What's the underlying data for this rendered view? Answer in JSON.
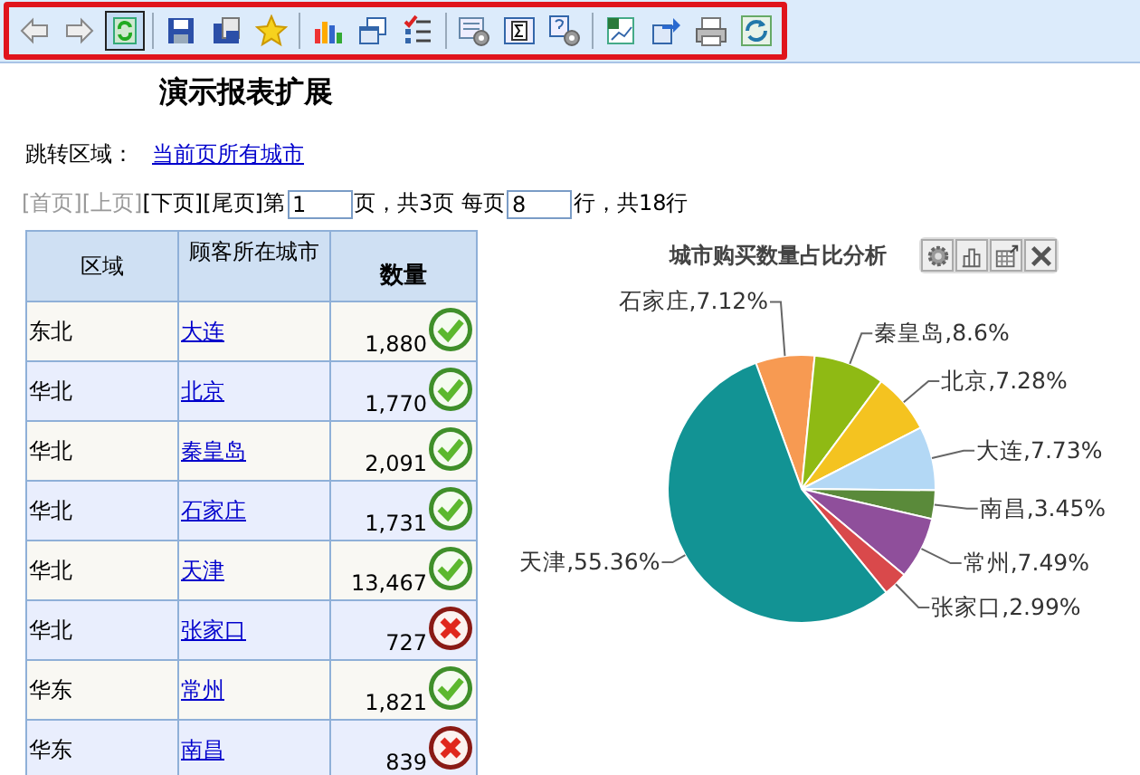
{
  "toolbar": {
    "highlighted": true,
    "groups": [
      [
        {
          "kind": "back",
          "selected": false
        },
        {
          "kind": "forward",
          "selected": false
        },
        {
          "kind": "refresh",
          "selected": true
        }
      ],
      [
        {
          "kind": "save",
          "selected": false
        },
        {
          "kind": "save-as",
          "selected": false
        },
        {
          "kind": "star",
          "selected": false
        }
      ],
      [
        {
          "kind": "chart",
          "selected": false
        },
        {
          "kind": "windows",
          "selected": false
        },
        {
          "kind": "checklist",
          "selected": false
        }
      ],
      [
        {
          "kind": "settings",
          "selected": false
        },
        {
          "kind": "sigma",
          "selected": false
        },
        {
          "kind": "help",
          "selected": false
        }
      ],
      [
        {
          "kind": "excel",
          "selected": false
        },
        {
          "kind": "export",
          "selected": false
        },
        {
          "kind": "print",
          "selected": false
        },
        {
          "kind": "reload",
          "selected": false
        }
      ]
    ]
  },
  "title": "演示报表扩展",
  "jump": {
    "label": "跳转区域：",
    "link": "当前页所有城市"
  },
  "pager": {
    "links": [
      {
        "text": "[首页]",
        "disabled": true
      },
      {
        "text": "[上页]",
        "disabled": true
      },
      {
        "text": "[下页]",
        "disabled": false
      },
      {
        "text": "[尾页]",
        "disabled": false
      }
    ],
    "prefix": "第",
    "page": "1",
    "middle": "页，共3页 每页",
    "per_page": "8",
    "suffix": "行，共18行"
  },
  "table": {
    "columns": [
      "区域",
      "顾客所在城市",
      "数量"
    ],
    "rows": [
      {
        "region": "东北",
        "city": "大连",
        "quantity": "1,880",
        "passed": true
      },
      {
        "region": "华北",
        "city": "北京",
        "quantity": "1,770",
        "passed": true
      },
      {
        "region": "华北",
        "city": "秦皇岛",
        "quantity": "2,091",
        "passed": true
      },
      {
        "region": "华北",
        "city": "石家庄",
        "quantity": "1,731",
        "passed": true
      },
      {
        "region": "华北",
        "city": "天津",
        "quantity": "13,467",
        "passed": true
      },
      {
        "region": "华北",
        "city": "张家口",
        "quantity": "727",
        "passed": false
      },
      {
        "region": "华东",
        "city": "常州",
        "quantity": "1,821",
        "passed": true
      },
      {
        "region": "华东",
        "city": "南昌",
        "quantity": "839",
        "passed": false
      }
    ]
  },
  "chart": {
    "tools": [
      {
        "kind": "settings"
      },
      {
        "kind": "bar"
      },
      {
        "kind": "export"
      },
      {
        "kind": "close"
      }
    ],
    "chart_data": {
      "type": "pie",
      "title": "城市购买数量占比分析",
      "categories": [
        "石家庄",
        "秦皇岛",
        "北京",
        "大连",
        "南昌",
        "常州",
        "张家口",
        "天津"
      ],
      "values": [
        7.12,
        8.6,
        7.28,
        7.73,
        3.45,
        7.49,
        2.99,
        55.36
      ],
      "colors": [
        "#f79a52",
        "#8fba14",
        "#f4c320",
        "#b3d8f5",
        "#5a8a3a",
        "#8f4f9b",
        "#d9494b",
        "#129394"
      ],
      "value_labels": [
        ",7.12%",
        ",8.6%",
        ",7.28%",
        ",7.73%",
        ",3.45%",
        ",7.49%",
        ",2.99%",
        ",55.36%"
      ]
    }
  }
}
